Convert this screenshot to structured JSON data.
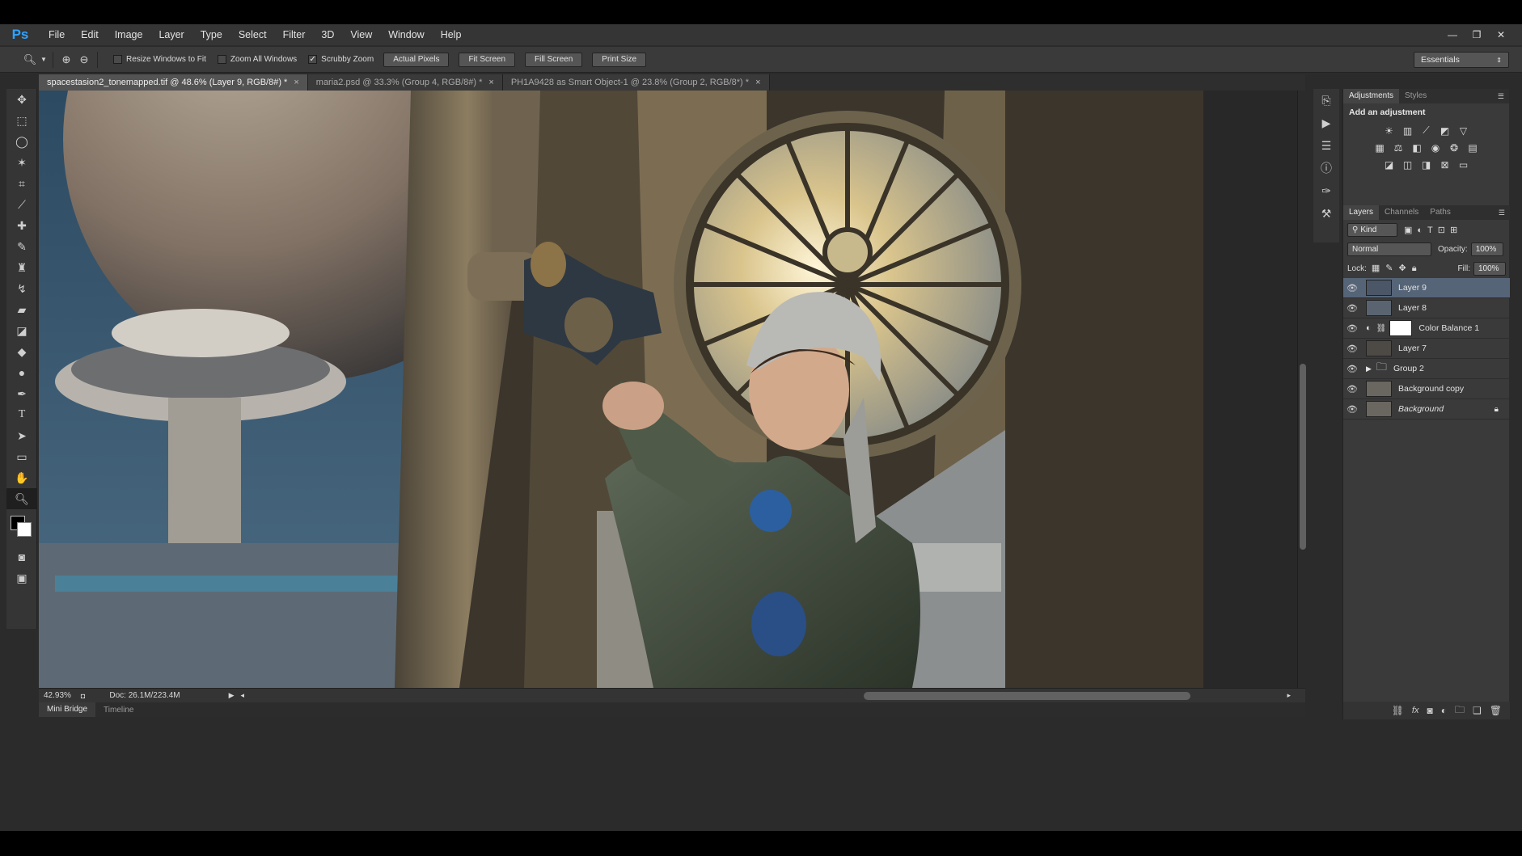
{
  "app": {
    "logo": "Ps"
  },
  "menu": [
    "File",
    "Edit",
    "Image",
    "Layer",
    "Type",
    "Select",
    "Filter",
    "3D",
    "View",
    "Window",
    "Help"
  ],
  "options": {
    "resize_windows": "Resize Windows to Fit",
    "zoom_all": "Zoom All Windows",
    "scrubby": "Scrubby Zoom",
    "scrubby_checked": "✓",
    "buttons": [
      "Actual Pixels",
      "Fit Screen",
      "Fill Screen",
      "Print Size"
    ],
    "workspace": "Essentials"
  },
  "tabs": [
    {
      "label": "spacestasion2_tonemapped.tif @ 48.6% (Layer 9, RGB/8#) *",
      "close": "×"
    },
    {
      "label": "maria2.psd @ 33.3% (Group 4, RGB/8#) *",
      "close": "×"
    },
    {
      "label": "PH1A9428 as Smart Object-1 @ 23.8% (Group 2, RGB/8*) *",
      "close": "×"
    }
  ],
  "status": {
    "zoom": "42.93%",
    "doc": "Doc: 26.1M/223.4M"
  },
  "bottom_tabs": [
    "Mini Bridge",
    "Timeline"
  ],
  "panels": {
    "adjustments": {
      "tab1": "Adjustments",
      "tab2": "Styles",
      "heading": "Add an adjustment"
    },
    "layers": {
      "tab1": "Layers",
      "tab2": "Channels",
      "tab3": "Paths",
      "kind": "Kind",
      "blend": "Normal",
      "opacity_label": "Opacity:",
      "opacity": "100%",
      "lock_label": "Lock:",
      "fill_label": "Fill:",
      "fill": "100%",
      "items": [
        {
          "name": "Layer 9"
        },
        {
          "name": "Layer 8"
        },
        {
          "name": "Color Balance 1"
        },
        {
          "name": "Layer 7"
        },
        {
          "name": "Group 2"
        },
        {
          "name": "Background copy"
        },
        {
          "name": "Background"
        }
      ]
    }
  },
  "colors": {
    "accent": "#2fa3ff",
    "selected_layer": "#566478"
  }
}
